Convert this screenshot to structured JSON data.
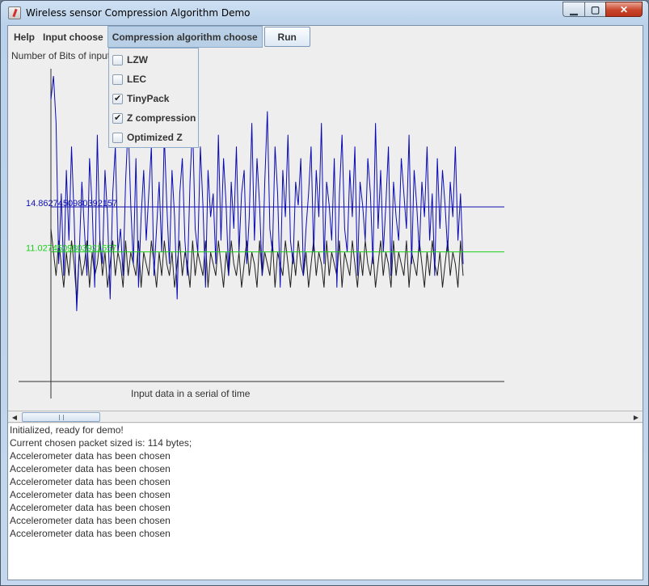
{
  "window": {
    "title": "Wireless sensor Compression Algorithm Demo"
  },
  "menubar": {
    "items": [
      {
        "label": "Help"
      },
      {
        "label": "Input choose"
      },
      {
        "label": "Compression algorithm choose"
      }
    ],
    "run_label": "Run"
  },
  "dropdown": {
    "items": [
      {
        "label": "LZW",
        "checked": false
      },
      {
        "label": "LEC",
        "checked": false
      },
      {
        "label": "TinyPack",
        "checked": true
      },
      {
        "label": "Z compression",
        "checked": true
      },
      {
        "label": "Optimized Z",
        "checked": false
      }
    ]
  },
  "chart_data": {
    "type": "line",
    "ylabel": "Number of Bits of input",
    "xlabel": "Input data in a serial of time",
    "ylim": [
      0,
      28
    ],
    "grid": false,
    "reference_lines": [
      {
        "label": "14.8627450980392157",
        "value": 14.86,
        "color": "#1010b0"
      },
      {
        "label": "11.0274509803921557",
        "value": 11.03,
        "color": "#18d018"
      }
    ],
    "series": [
      {
        "color": "#0a0ab4",
        "values": [
          24,
          26,
          22,
          10,
          16,
          9,
          18,
          12,
          20,
          14,
          6,
          11,
          17,
          13,
          9,
          19,
          15,
          8,
          21,
          12,
          10,
          18,
          14,
          7,
          16,
          20,
          11,
          13,
          9,
          17,
          22,
          15,
          10,
          19,
          8,
          14,
          18,
          12,
          16,
          20,
          9,
          13,
          17,
          11,
          21,
          15,
          10,
          18,
          14,
          7,
          16,
          19,
          12,
          9,
          17,
          22,
          13,
          11,
          20,
          15,
          8,
          18,
          14,
          16,
          10,
          21,
          12,
          19,
          15,
          9,
          17,
          13,
          20,
          11,
          16,
          18,
          10,
          14,
          22,
          12,
          19,
          15,
          9,
          17,
          23,
          13,
          11,
          20,
          16,
          8,
          18,
          14,
          21,
          12,
          10,
          17,
          15,
          19,
          9,
          13,
          16,
          20,
          11,
          18,
          14,
          22,
          10,
          17,
          15,
          12,
          19,
          8,
          16,
          21,
          13,
          11,
          18,
          14,
          20,
          9,
          17,
          15,
          12,
          19,
          16,
          10,
          22,
          13,
          18,
          11,
          15,
          20,
          9,
          17,
          14,
          12,
          19,
          16,
          13,
          21,
          10,
          18,
          15,
          11,
          17,
          14,
          20,
          12,
          16,
          9,
          19,
          13,
          18,
          15,
          11,
          17,
          14,
          20,
          12,
          16,
          10
        ]
      },
      {
        "color": "#202020",
        "values": [
          13,
          11,
          9,
          12,
          10,
          8,
          11,
          9,
          12,
          10,
          7,
          11,
          9,
          10,
          12,
          8,
          11,
          9,
          10,
          12,
          9,
          11,
          8,
          10,
          12,
          9,
          11,
          10,
          8,
          12,
          9,
          11,
          10,
          9,
          12,
          8,
          11,
          10,
          9,
          12,
          10,
          8,
          11,
          9,
          12,
          10,
          9,
          11,
          8,
          10,
          12,
          9,
          11,
          10,
          8,
          12,
          9,
          11,
          10,
          9,
          12,
          8,
          11,
          10,
          9,
          12,
          10,
          8,
          11,
          9,
          12,
          10,
          9,
          11,
          8,
          10,
          12,
          9,
          11,
          10,
          8,
          12,
          9,
          11,
          10,
          9,
          12,
          8,
          11,
          10,
          9,
          12,
          10,
          8,
          11,
          9,
          12,
          10,
          9,
          11,
          8,
          10,
          12,
          9,
          11,
          10,
          8,
          12,
          9,
          11,
          10,
          9,
          12,
          8,
          11,
          10,
          9,
          12,
          10,
          8,
          11,
          9,
          12,
          10,
          9,
          11,
          8,
          10,
          12,
          9,
          11,
          10,
          8,
          12,
          9,
          11,
          10,
          9,
          12,
          8,
          11,
          10,
          9,
          12,
          10,
          8,
          11,
          9,
          12,
          10,
          9,
          11,
          8,
          10,
          12,
          9,
          11,
          10,
          8,
          12,
          9
        ]
      }
    ]
  },
  "log": {
    "lines": [
      "Initialized, ready for demo!",
      "Current chosen packet sized is: 114 bytes;",
      "Accelerometer data has been chosen",
      "Accelerometer data has been chosen",
      "Accelerometer data has been chosen",
      "Accelerometer data has been chosen",
      "Accelerometer data has been chosen",
      "Accelerometer data has been chosen",
      "Accelerometer data has been chosen"
    ]
  }
}
